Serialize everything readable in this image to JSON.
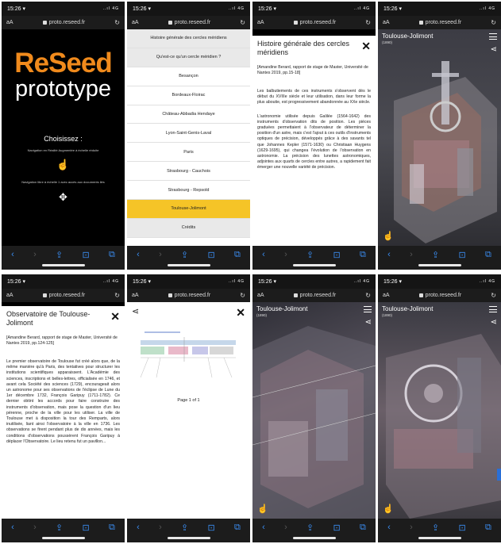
{
  "common": {
    "url": "proto.reseed.fr",
    "text_size_label": "aA",
    "status_right": "..ıl 4G"
  },
  "phones": [
    {
      "time": "15:26 ▾",
      "brand_top": "ReSeed",
      "brand_bottom": "prototype",
      "choose_label": "Choisissez :",
      "note_1": "Navigation en Réalité Augmentée à échelle réduite",
      "note_2": "Navigation libre à échelle 1 avec accès aux documents liés"
    },
    {
      "time": "15:26 ▾",
      "menu": [
        {
          "label": "Histoire générale des cercles méridiens",
          "style": "grey"
        },
        {
          "label": "Qu'est-ce qu'un cercle méridien ?",
          "style": "grey"
        },
        {
          "label": "Besançon",
          "style": "plain"
        },
        {
          "label": "Bordeaux-Floirac",
          "style": "plain"
        },
        {
          "label": "Château-Abbadia Hendaye",
          "style": "plain"
        },
        {
          "label": "Lyon-Saint-Genis-Laval",
          "style": "plain"
        },
        {
          "label": "Paris",
          "style": "plain"
        },
        {
          "label": "Strasbourg - Cauchois",
          "style": "plain"
        },
        {
          "label": "Strasbourg - Repsold",
          "style": "plain"
        },
        {
          "label": "Toulouse-Jolimont",
          "style": "active"
        },
        {
          "label": "Crédits",
          "style": "grey"
        }
      ]
    },
    {
      "time": "15:26 ▾",
      "title": "Histoire générale des cercles méridiens",
      "reference": "[Amandine Berard, rapport de stage de Master, Université de Nantes 2019, pp.15-18]",
      "paragraph_1": "Les balbutiements de ces instruments s'observent dès le début du XVIIIe siècle et leur utilisation, dans leur forme la plus aboutie, est progressivement abandonnée au XXe siècle.",
      "paragraph_2": "L'astronomie utilisée depuis Galilée (1564-1642) des instruments d'observation dits de position. Les pièces graduées permettaient à l'observateur de déterminer la position d'un astre, mais c'est l'ajout à ces outils d'instruments optiques de précision, développés grâce à des savants tel que Johannes Kepler (1571-1630) ou Christiaan Huygens (1629-1695), qui changea l'évolution de l'observation en astronomie. La précision des lunettes astronomiques, adjointes aux quarts de cercles entre autres, a rapidement fait émerger une nouvelle variété de précision."
    },
    {
      "time": "15:26 ▾",
      "title": "Toulouse-Jolimont",
      "subtitle": "(1890)"
    },
    {
      "time": "15:26 ▾",
      "title": "Observatoire de Toulouse-Jolimont",
      "reference": "[Amandine Berard, rapport de stage de Master, Université de Nantes 2019, pp.124-125]",
      "paragraph_1": "Le premier observatoire de Toulouse fut créé alors que, de la même manière qu'à Paris, des tentatives pour structurer les institutions scientifiques apparaissent. L'Académie des sciences, inscriptions et belles-lettres, officialisée en 1746, et avant cela Société des sciences (1729), encourageait alors un astronome pour ses observations de l'éclipse de Lune du 1er décembre 1732, François Garipuy (1711-1782). Ce dernier obtint les accords pour faire construire des instruments d'observation, mais pose la question d'un lieu pérenne, proche de la ville pour les utiliser. La ville de Toulouse met à disposition la tour des Remparts, alors inutilisée, liant ainsi l'observatoire à la ville en 1736. Les observations se firent pendant plus de dix années, mais les conditions d'observations poussèrent François Garipuy à déplacer l'Observatoire. Le lieu retenu fut un pavillon..."
    },
    {
      "time": "15:26 ▾",
      "page_label": "Page 1 of 1"
    },
    {
      "time": "15:26 ▾",
      "title": "Toulouse-Jolimont",
      "subtitle": "(1890)"
    },
    {
      "time": "15:26 ▾",
      "title": "Toulouse-Jolimont",
      "subtitle": "(1890)"
    }
  ],
  "icons": {
    "back": "‹",
    "forward": "›",
    "share": "⇪",
    "bookmarks": "⊡",
    "tabs": "⧉",
    "reload": "↻",
    "close": "✕",
    "share_nodes": "⋖",
    "hand": "☝",
    "move": "✥"
  },
  "colors": {
    "brand_orange": "#f08a1c",
    "active_yellow": "#f5c427",
    "ios_blue": "#3a8cf0"
  }
}
